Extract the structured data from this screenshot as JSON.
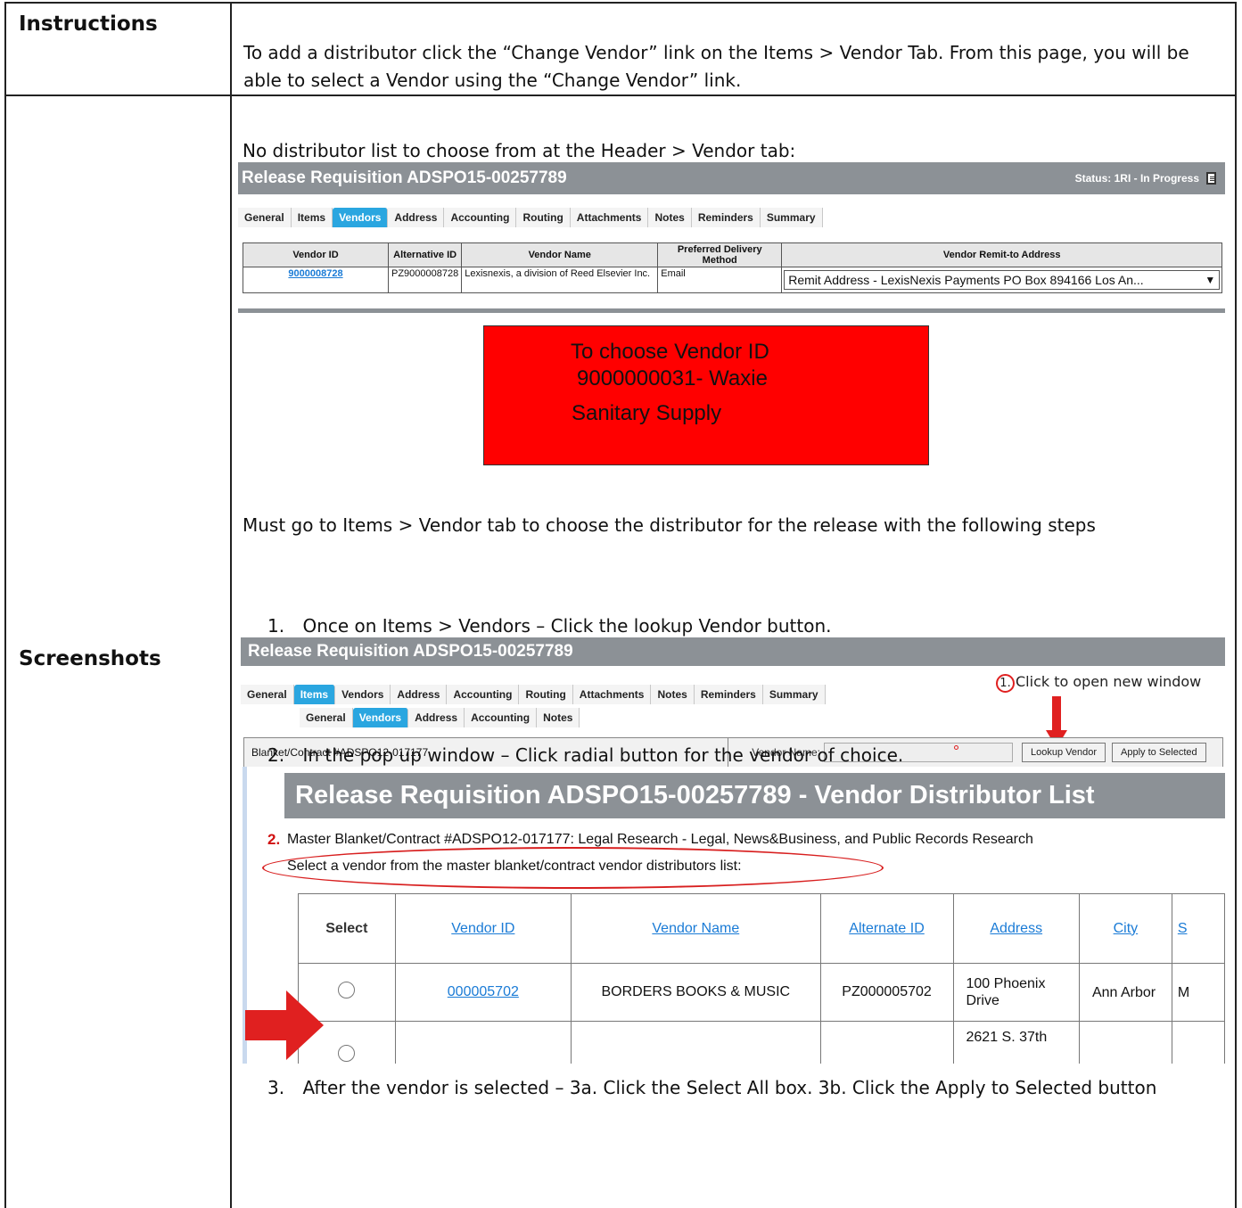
{
  "labels": {
    "instructions": "Instructions",
    "screenshots": "Screenshots"
  },
  "instructions_text": "To add a distributor click the “Change Vendor” link on the Items > Vendor Tab. From this page,  you will be able to select a Vendor using the “Change Vendor”  link.",
  "intro_text": "No distributor list to choose from at the Header > Vendor tab:",
  "shot1": {
    "title": "Release Requisition ADSPO15-00257789",
    "status": "Status: 1RI - In Progress",
    "tabs": [
      "General",
      "Items",
      "Vendors",
      "Address",
      "Accounting",
      "Routing",
      "Attachments",
      "Notes",
      "Reminders",
      "Summary"
    ],
    "active_tab": "Vendors",
    "columns": [
      "Vendor ID",
      "Alternative ID",
      "Vendor Name",
      "Preferred Delivery Method",
      "Vendor Remit-to Address"
    ],
    "row": {
      "vendor_id": "9000008728",
      "alt_id": "PZ9000008728",
      "name": "Lexisnexis, a division of Reed Elsevier Inc.",
      "delivery": "Email",
      "remit": "Remit Address - LexisNexis Payments PO Box 894166 Los An..."
    }
  },
  "callout": {
    "line1": "To choose Vendor ID",
    "line2": "9000000031- Waxie",
    "line3": "Sanitary Supply",
    "color": "#ff0000"
  },
  "must_go_text": "Must go to Items > Vendor tab to choose the distributor for the release with the following steps",
  "steps": [
    {
      "num": "1.",
      "text": "Once on Items > Vendors – Click the lookup Vendor button."
    },
    {
      "num": "2.",
      "text": "In the pop up window – Click radial button for the vendor of choice."
    },
    {
      "num": "3.",
      "text": "After the vendor is selected – 3a. Click the Select All box. 3b. Click the Apply to Selected button"
    }
  ],
  "shot2": {
    "title": "Release Requisition ADSPO15-00257789",
    "tabs": [
      "General",
      "Items",
      "Vendors",
      "Address",
      "Accounting",
      "Routing",
      "Attachments",
      "Notes",
      "Reminders",
      "Summary"
    ],
    "active_tab": "Items",
    "subtabs": [
      "General",
      "Vendors",
      "Address",
      "Accounting",
      "Notes"
    ],
    "active_subtab": "Vendors",
    "blanket": "Blanket/Contract #ADSPO12-017177",
    "vendor_name_label": "Vendor Name:",
    "lookup_button": "Lookup Vendor",
    "apply_button": "Apply to Selected",
    "annotation_num": "1.",
    "annotation_text": "Click to open new window"
  },
  "shot3": {
    "title": "Release Requisition ADSPO15-00257789 - Vendor Distributor List",
    "step_marker": "2.",
    "master": "Master Blanket/Contract #ADSPO12-017177: Legal Research - Legal, News&Business, and Public Records Research",
    "select_prompt": "Select a vendor from the master blanket/contract vendor distributors list:",
    "columns": [
      "Select",
      "Vendor ID",
      "Vendor Name",
      "Alternate ID",
      "Address",
      "City",
      "S"
    ],
    "row": {
      "vendor_id": "000005702",
      "name": "BORDERS BOOKS & MUSIC",
      "alt_id": "PZ000005702",
      "address": "100 Phoenix Drive",
      "city": "Ann Arbor",
      "state": "M"
    },
    "next_address": "2621 S. 37th"
  }
}
